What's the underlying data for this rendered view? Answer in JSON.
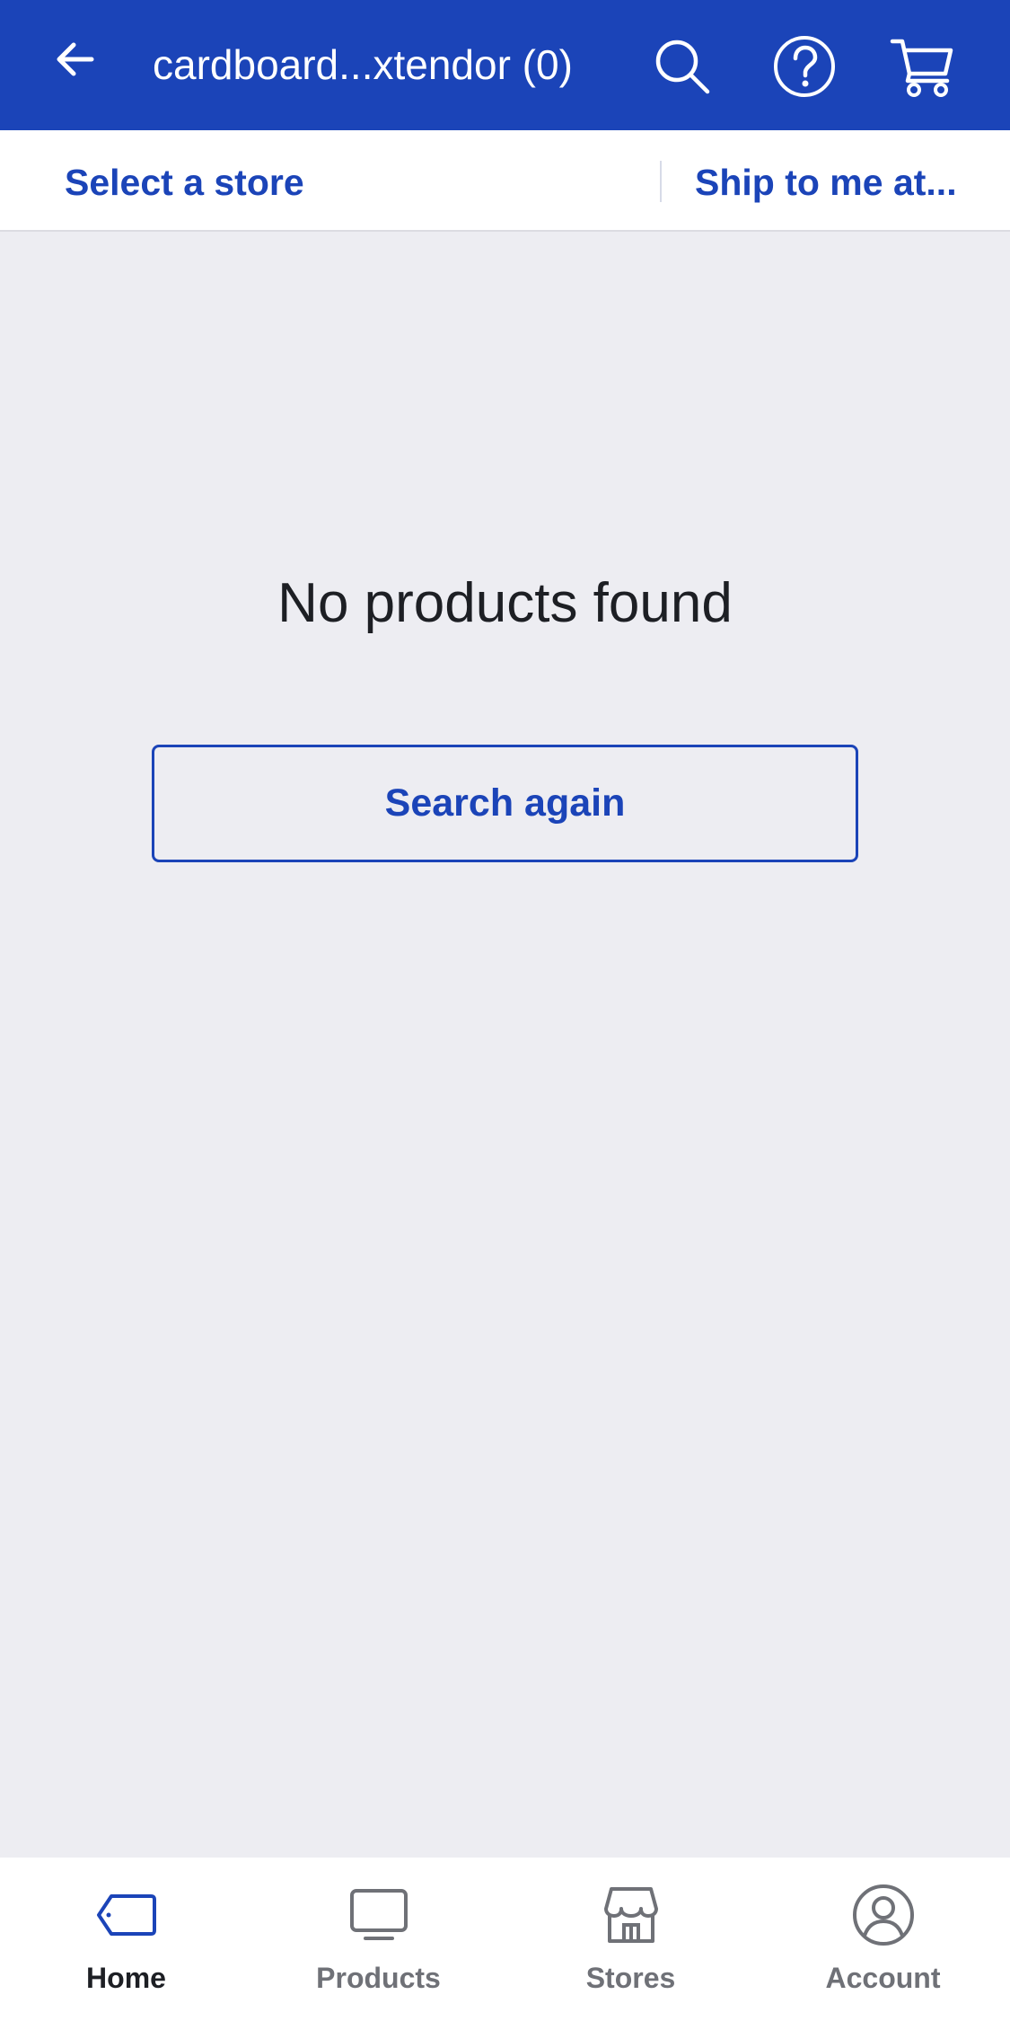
{
  "header": {
    "title": "cardboard...xtendor (0)",
    "back_icon": "arrow-left-icon",
    "search_icon": "search-icon",
    "help_icon": "help-circle-icon",
    "cart_icon": "cart-icon",
    "background_color": "#1b44b8"
  },
  "store_bar": {
    "select_store": "Select a store",
    "ship_to": "Ship to me at..."
  },
  "main": {
    "empty_message": "No products found",
    "search_again_label": "Search again"
  },
  "bottom_nav": {
    "items": [
      {
        "label": "Home",
        "icon": "tag-icon",
        "active": true
      },
      {
        "label": "Products",
        "icon": "monitor-icon",
        "active": false
      },
      {
        "label": "Stores",
        "icon": "store-icon",
        "active": false
      },
      {
        "label": "Account",
        "icon": "account-icon",
        "active": false
      }
    ]
  },
  "colors": {
    "accent": "#1b44b8",
    "background": "#ededf2",
    "text": "#1d1f24",
    "inactive": "#6f7177"
  }
}
